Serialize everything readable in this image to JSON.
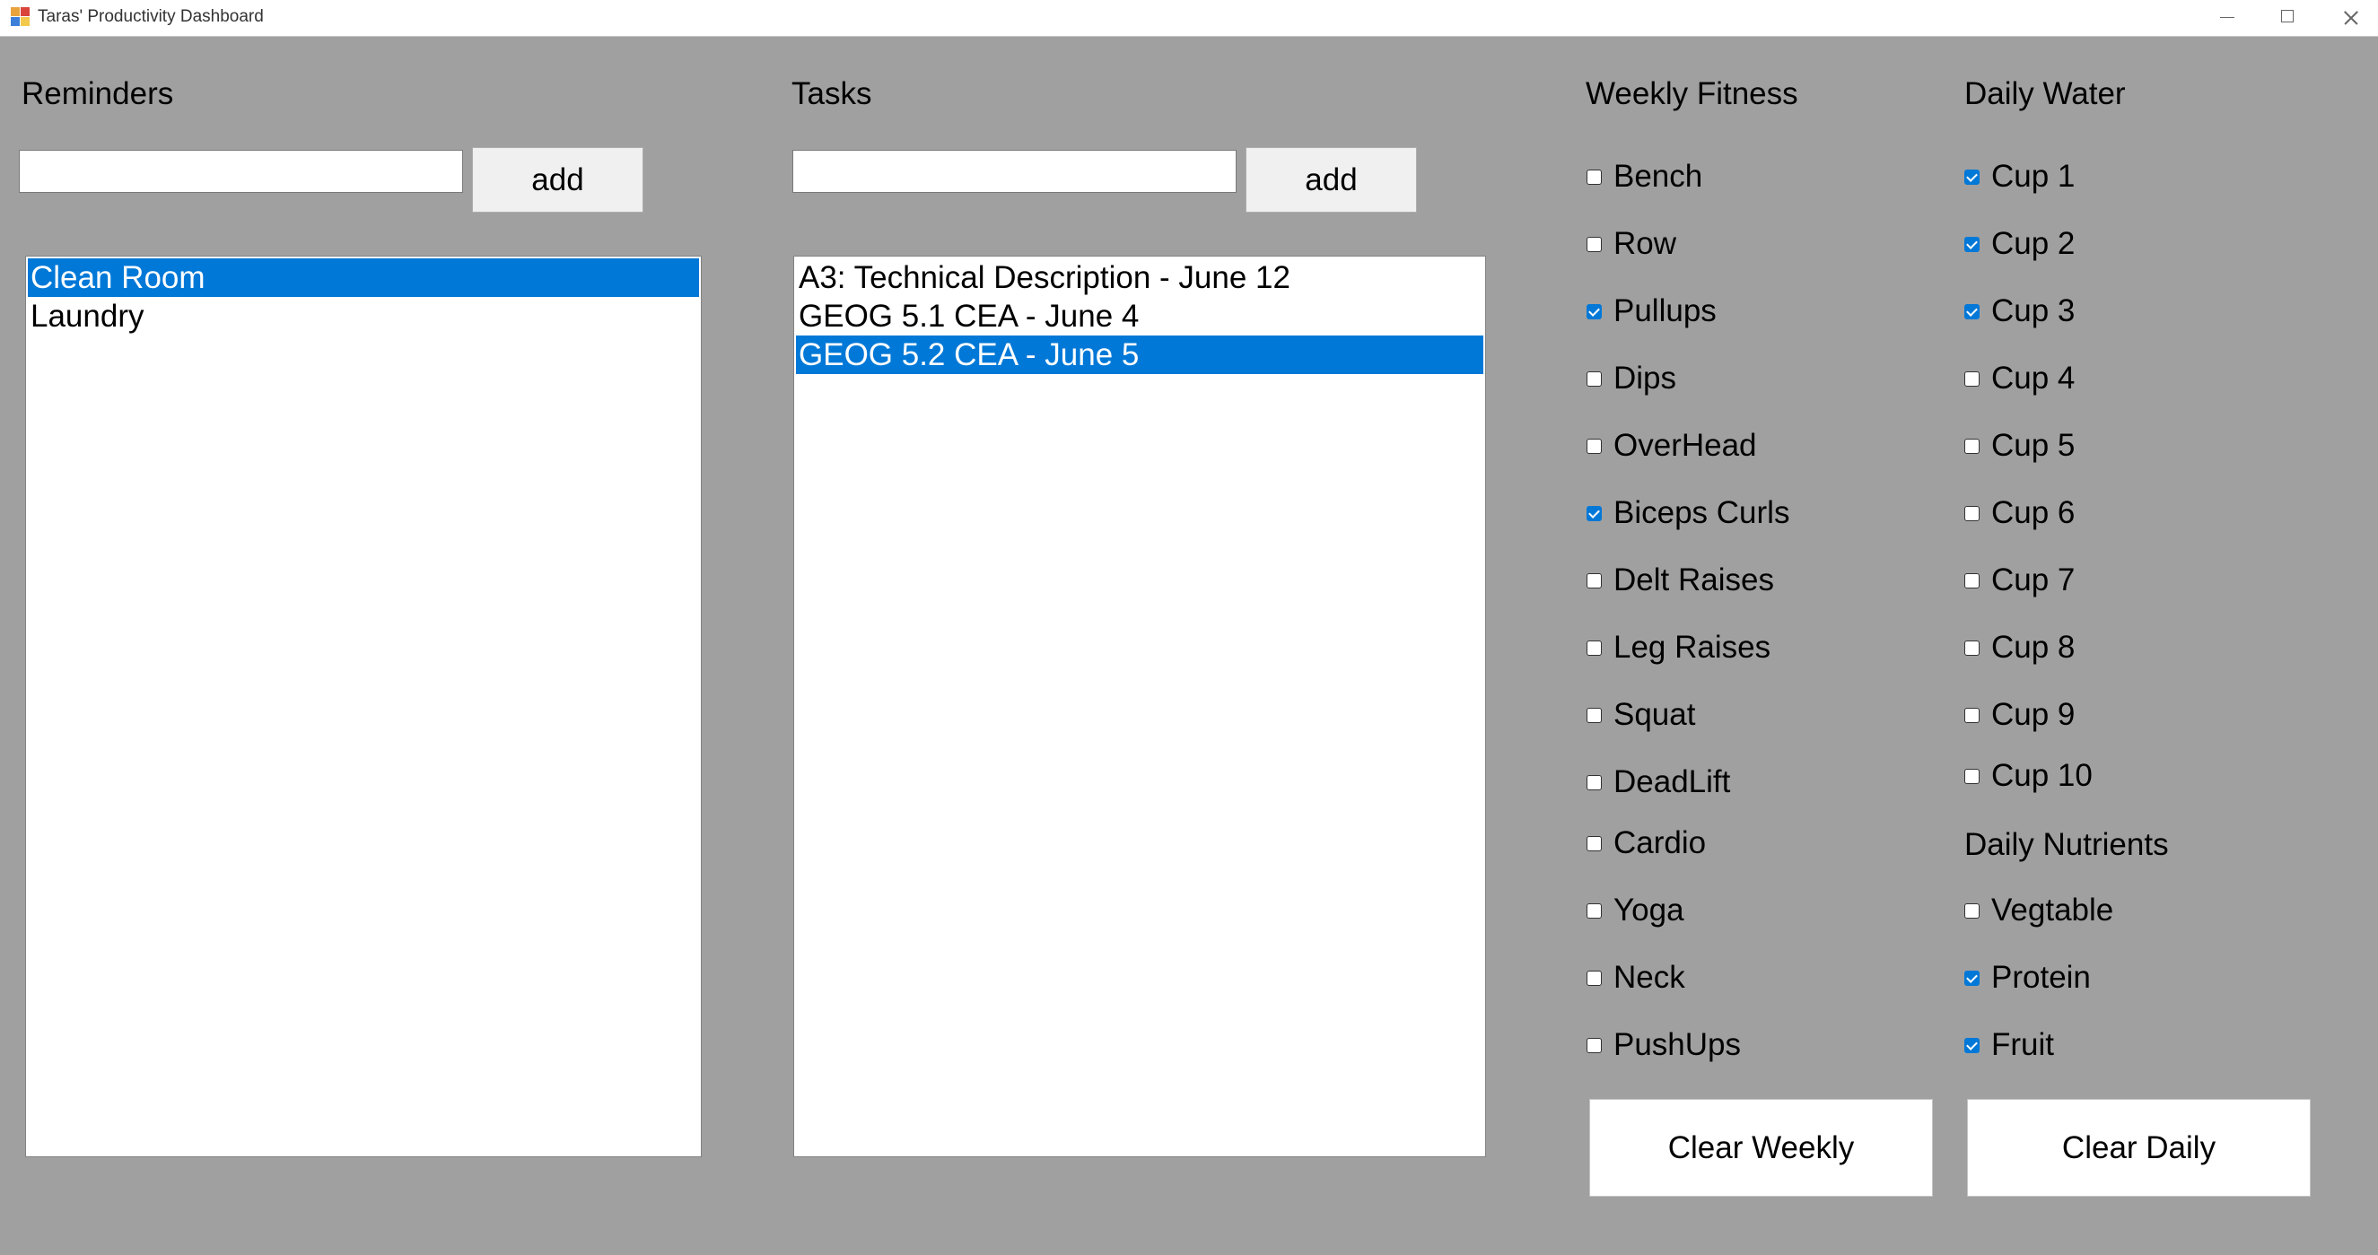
{
  "window": {
    "title": "Taras' Productivity Dashboard"
  },
  "reminders": {
    "header": "Reminders",
    "add_label": "add",
    "input_value": "",
    "items": [
      {
        "text": "Clean Room",
        "selected": true
      },
      {
        "text": "Laundry",
        "selected": false
      }
    ]
  },
  "tasks": {
    "header": "Tasks",
    "add_label": "add",
    "input_value": "",
    "items": [
      {
        "text": "A3: Technical Description - June 12",
        "selected": false
      },
      {
        "text": "GEOG 5.1 CEA - June 4",
        "selected": false
      },
      {
        "text": "GEOG 5.2 CEA - June 5",
        "selected": true
      }
    ]
  },
  "weekly_fitness": {
    "header": "Weekly Fitness",
    "items": [
      {
        "label": "Bench",
        "checked": false
      },
      {
        "label": "Row",
        "checked": false
      },
      {
        "label": "Pullups",
        "checked": true
      },
      {
        "label": "Dips",
        "checked": false
      },
      {
        "label": "OverHead",
        "checked": false
      },
      {
        "label": "Biceps Curls",
        "checked": true
      },
      {
        "label": "Delt Raises",
        "checked": false
      },
      {
        "label": "Leg Raises",
        "checked": false
      },
      {
        "label": "Squat",
        "checked": false
      },
      {
        "label": "DeadLift",
        "checked": false
      },
      {
        "label": "Cardio",
        "checked": false
      },
      {
        "label": "Yoga",
        "checked": false
      },
      {
        "label": "Neck",
        "checked": false
      },
      {
        "label": "PushUps",
        "checked": false
      }
    ],
    "clear_label": "Clear Weekly"
  },
  "daily_water": {
    "header": "Daily Water",
    "items": [
      {
        "label": "Cup 1",
        "checked": true
      },
      {
        "label": "Cup 2",
        "checked": true
      },
      {
        "label": "Cup 3",
        "checked": true
      },
      {
        "label": "Cup 4",
        "checked": false
      },
      {
        "label": "Cup 5",
        "checked": false
      },
      {
        "label": "Cup 6",
        "checked": false
      },
      {
        "label": "Cup 7",
        "checked": false
      },
      {
        "label": "Cup 8",
        "checked": false
      },
      {
        "label": "Cup 9",
        "checked": false
      },
      {
        "label": "Cup 10",
        "checked": false
      }
    ]
  },
  "daily_nutrients": {
    "header": "Daily Nutrients",
    "items": [
      {
        "label": "Vegtable",
        "checked": false
      },
      {
        "label": "Protein",
        "checked": true
      },
      {
        "label": "Fruit",
        "checked": true
      }
    ],
    "clear_label": "Clear Daily"
  },
  "colors": {
    "accent": "#0078d7",
    "background": "#a0a0a0"
  }
}
